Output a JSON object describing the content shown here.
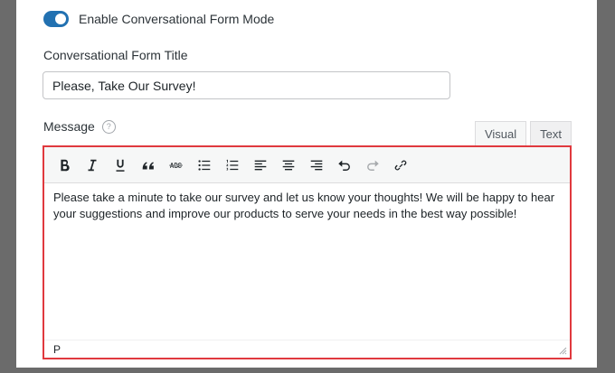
{
  "toggle": {
    "label": "Enable Conversational Form Mode",
    "enabled": true
  },
  "title_field": {
    "label": "Conversational Form Title",
    "value": "Please, Take Our Survey!"
  },
  "message": {
    "label": "Message",
    "help_glyph": "?",
    "tabs": [
      "Visual",
      "Text"
    ],
    "body": "Please take a minute to take our survey and let us know your thoughts! We will be happy to hear your suggestions and improve our products to serve your needs in the best way possible!",
    "status_path": "P"
  },
  "toolbar_icons": [
    "bold-icon",
    "italic-icon",
    "underline-icon",
    "blockquote-icon",
    "strikethrough-icon",
    "bulleted-list-icon",
    "numbered-list-icon",
    "align-left-icon",
    "align-center-icon",
    "align-right-icon",
    "undo-icon",
    "redo-icon",
    "link-icon"
  ],
  "colors": {
    "accent": "#2271b1",
    "highlight_border": "#e0393e"
  }
}
